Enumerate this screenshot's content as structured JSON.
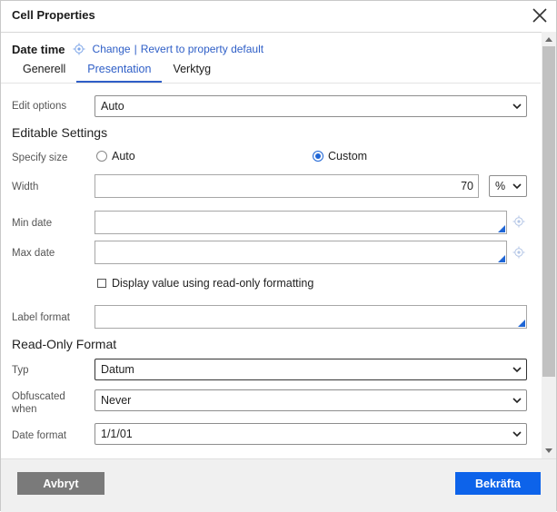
{
  "dialog": {
    "title": "Cell Properties"
  },
  "property": {
    "name": "Date time",
    "change_label": "Change",
    "separator": "|",
    "revert_label": "Revert to property default"
  },
  "tabs": [
    {
      "label": "Generell",
      "active": false
    },
    {
      "label": "Presentation",
      "active": true
    },
    {
      "label": "Verktyg",
      "active": false
    }
  ],
  "edit_options": {
    "label": "Edit options",
    "value": "Auto"
  },
  "editable_settings": {
    "heading": "Editable Settings",
    "specify_size": {
      "label": "Specify size",
      "options": [
        {
          "label": "Auto",
          "checked": false
        },
        {
          "label": "Custom",
          "checked": true
        }
      ]
    },
    "width": {
      "label": "Width",
      "value": "70",
      "unit": "%"
    },
    "min_date": {
      "label": "Min date",
      "value": ""
    },
    "max_date": {
      "label": "Max date",
      "value": ""
    },
    "readonly_checkbox": {
      "label": "Display value using read-only formatting",
      "checked": false
    },
    "label_format": {
      "label": "Label format",
      "value": ""
    }
  },
  "read_only_format": {
    "heading": "Read-Only Format",
    "typ": {
      "label": "Typ",
      "value": "Datum"
    },
    "obfuscated": {
      "label": "Obfuscated when",
      "value": "Never"
    },
    "date_format": {
      "label": "Date format",
      "value": "1/1/01"
    }
  },
  "footer": {
    "cancel_label": "Avbryt",
    "confirm_label": "Bekräfta"
  },
  "colors": {
    "accent": "#0d63ea",
    "link": "#2f5fc7",
    "cancel_bg": "#7a7a7a"
  }
}
